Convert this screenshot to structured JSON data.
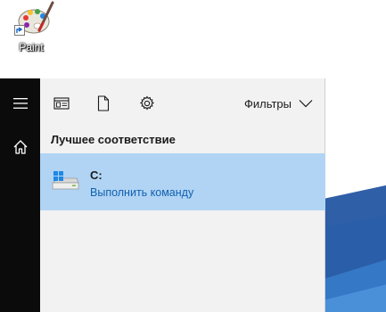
{
  "desktop": {
    "icons": [
      {
        "label": "Paint",
        "icon": "paint-palette-icon"
      }
    ]
  },
  "start_menu": {
    "rail": [
      {
        "icon": "hamburger-menu-icon"
      },
      {
        "icon": "home-icon"
      }
    ]
  },
  "search": {
    "toolbar": {
      "buttons": [
        {
          "icon": "apps-filter-icon"
        },
        {
          "icon": "documents-filter-icon"
        },
        {
          "icon": "settings-filter-icon"
        }
      ],
      "filters_label": "Фильтры",
      "filters_icon": "chevron-down-icon"
    },
    "best_match_title": "Лучшее соответствие",
    "best_match": {
      "name": "C:",
      "subtitle": "Выполнить команду",
      "icon": "drive-icon"
    }
  },
  "colors": {
    "accent": "#b1d4f4",
    "link": "#1060b0",
    "rail": "#0b0b0b",
    "panel": "#f2f2f2"
  }
}
